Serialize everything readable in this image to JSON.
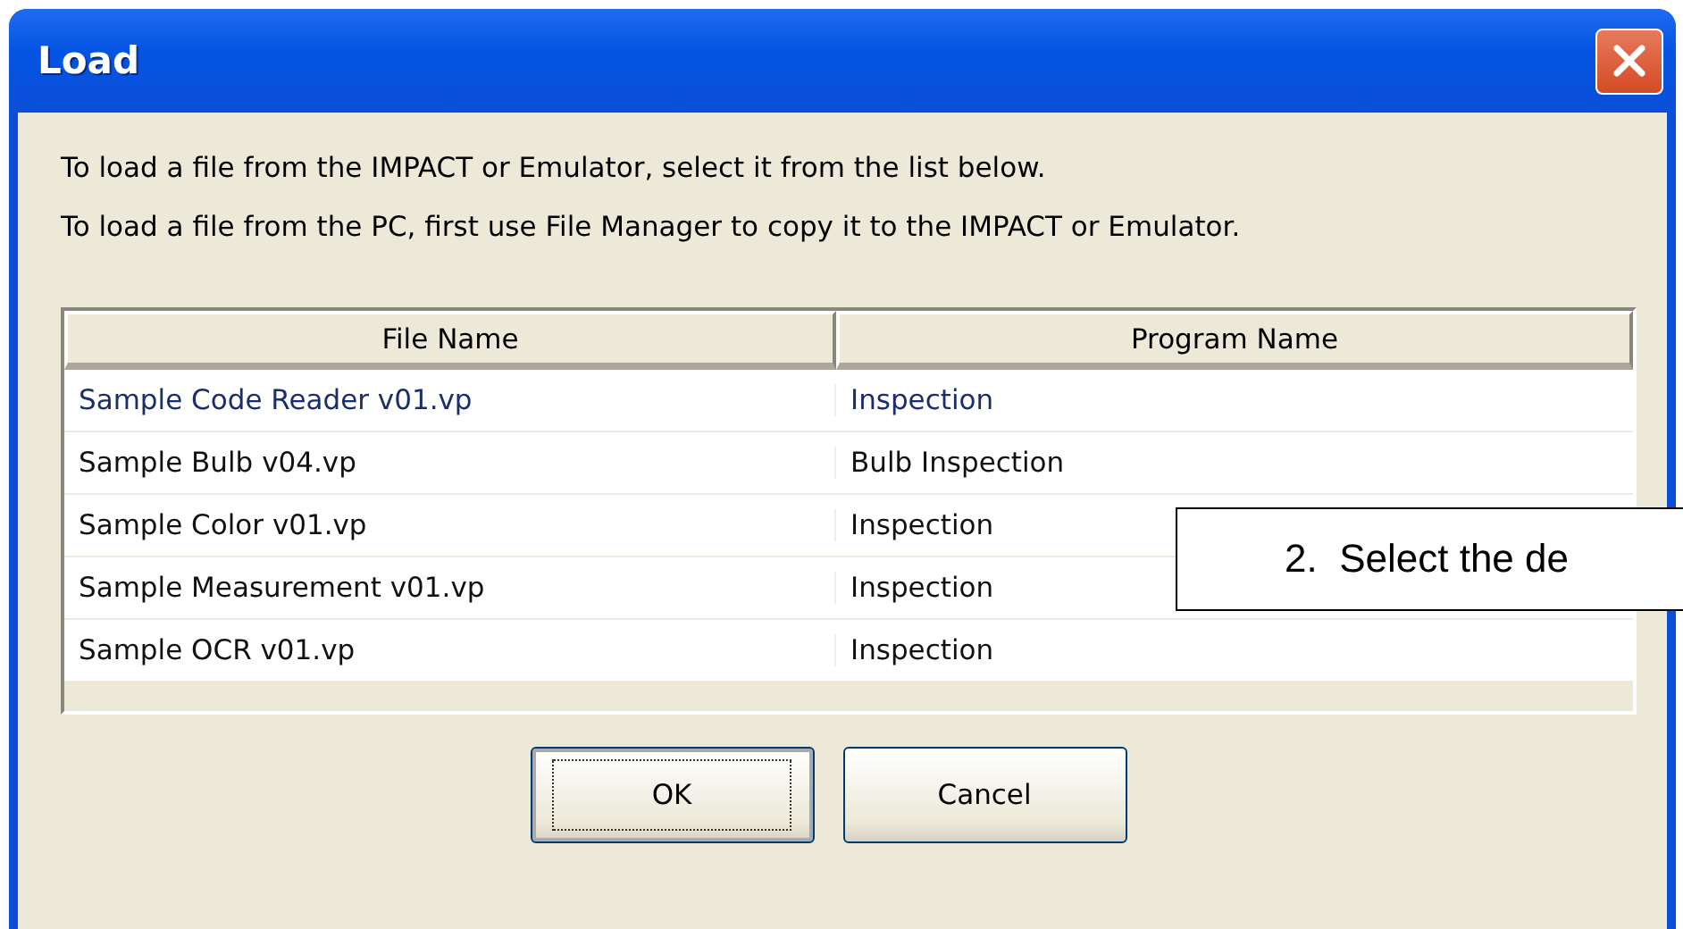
{
  "window": {
    "title": "Load"
  },
  "instructions": [
    "To load a file from the IMPACT or Emulator, select it from the list below.",
    "To load a file from the PC, first use File Manager to copy it to the IMPACT or Emulator."
  ],
  "table": {
    "columns": [
      "File Name",
      "Program Name"
    ],
    "rows": [
      {
        "cells": [
          "Sample Code Reader v01.vp",
          "Inspection"
        ],
        "selected": true
      },
      {
        "cells": [
          "Sample Bulb v04.vp",
          "Bulb Inspection"
        ],
        "selected": false
      },
      {
        "cells": [
          "Sample Color v01.vp",
          "Inspection"
        ],
        "selected": false
      },
      {
        "cells": [
          "Sample Measurement v01.vp",
          "Inspection"
        ],
        "selected": false
      },
      {
        "cells": [
          "Sample OCR v01.vp",
          "Inspection"
        ],
        "selected": false
      }
    ]
  },
  "buttons": [
    {
      "label": "OK",
      "focused": true
    },
    {
      "label": "Cancel",
      "focused": false
    }
  ],
  "callout": {
    "text": "2.  Select the de"
  }
}
